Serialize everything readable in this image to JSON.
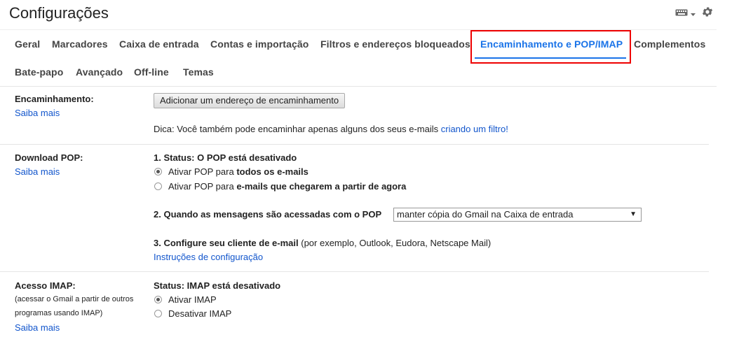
{
  "header": {
    "title": "Configurações"
  },
  "tabs": [
    {
      "label": "Geral"
    },
    {
      "label": "Marcadores"
    },
    {
      "label": "Caixa de entrada"
    },
    {
      "label": "Contas e importação"
    },
    {
      "label": "Filtros e endereços bloqueados"
    },
    {
      "label": "Encaminhamento e POP/IMAP"
    },
    {
      "label": "Complementos"
    },
    {
      "label": "Bate-papo"
    },
    {
      "label": "Avançado"
    },
    {
      "label": "Off-line"
    },
    {
      "label": "Temas"
    }
  ],
  "forwarding": {
    "label": "Encaminhamento:",
    "learn_more": "Saiba mais",
    "add_button": "Adicionar um endereço de encaminhamento",
    "tip": "Dica: Você também pode encaminhar apenas alguns dos seus e-mails ",
    "tip_link": "criando um filtro!"
  },
  "pop": {
    "label": "Download POP:",
    "learn_more": "Saiba mais",
    "status": "1. Status: O POP está desativado",
    "option1_prefix": "Ativar POP para ",
    "option1_bold": "todos os e-mails",
    "option2_prefix": "Ativar POP para ",
    "option2_bold": "e-mails que chegarem a partir de agora",
    "when_accessed": "2. Quando as mensagens são acessadas com o POP",
    "select_value": "manter cópia do Gmail na Caixa de entrada",
    "configure_bold": "3. Configure seu cliente de e-mail",
    "configure_rest": " (por exemplo, Outlook, Eudora, Netscape Mail)",
    "instructions_link": "Instruções de configuração"
  },
  "imap": {
    "label": "Acesso IMAP:",
    "sub1": "(acessar o Gmail a partir de outros",
    "sub2": "programas usando IMAP)",
    "learn_more": "Saiba mais",
    "status": "Status: IMAP está desativado",
    "enable": "Ativar IMAP",
    "disable": "Desativar IMAP"
  },
  "colors": {
    "accent": "#1a73e8",
    "link": "#1155cc",
    "highlight": "#ee0000"
  }
}
